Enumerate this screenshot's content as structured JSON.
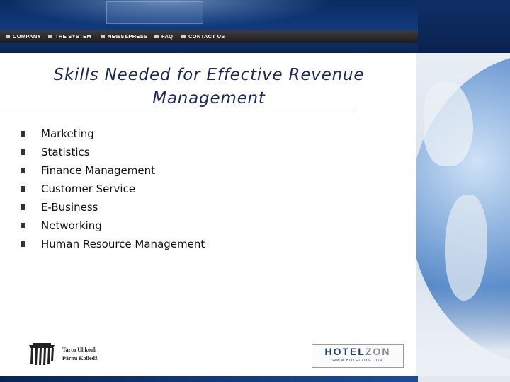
{
  "nav": {
    "items": [
      {
        "label": "COMPANY",
        "icon": "square-bullet-icon"
      },
      {
        "label": "THE SYSTEM",
        "icon": "square-bullet-icon"
      },
      {
        "label": "NEWS&PRESS",
        "icon": "square-bullet-icon"
      },
      {
        "label": "FAQ",
        "icon": "square-bullet-icon"
      },
      {
        "label": "CONTACT US",
        "icon": "square-bullet-icon"
      }
    ]
  },
  "slide": {
    "title_line1": "Skills Needed for Effective Revenue",
    "title_line2": "Management",
    "bullets": [
      "Marketing",
      "Statistics",
      "Finance Management",
      "Customer Service",
      "E-Business",
      "Networking",
      "Human Resource Management"
    ]
  },
  "footer": {
    "left_logo_line1": "Tartu Ülikooli",
    "left_logo_line2": "Pärnu Kolledž",
    "right_logo_part1": "HOTEL",
    "right_logo_part2": "ZON",
    "right_logo_url": "WWW.HOTELZON.COM"
  },
  "colors": {
    "header_blue": "#0b2c63",
    "title_color": "#1b2a5a",
    "brand_blue": "#1a3a78"
  }
}
